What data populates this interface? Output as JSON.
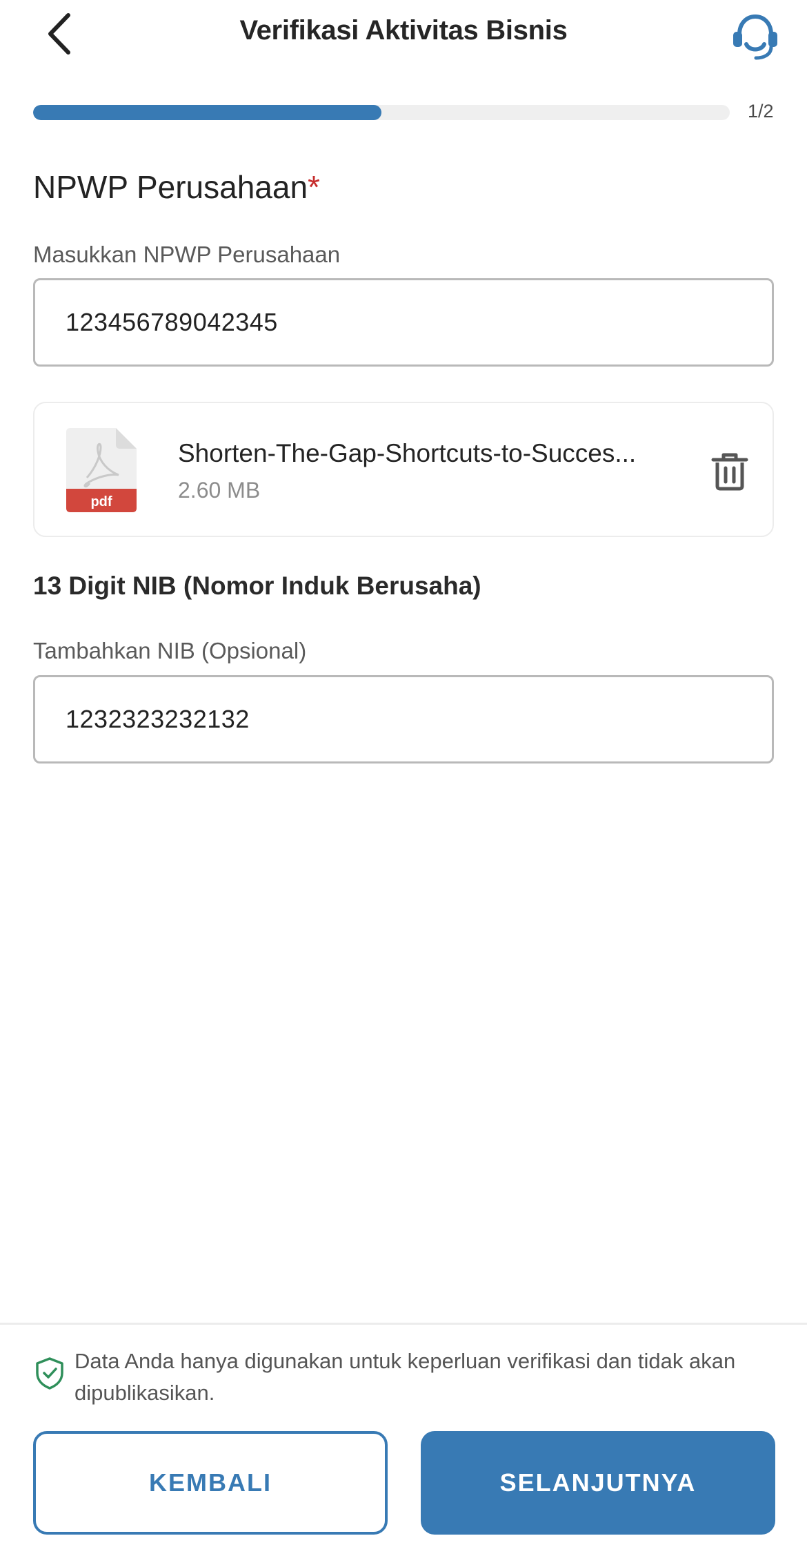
{
  "header": {
    "title": "Verifikasi Aktivitas Bisnis",
    "back_icon": "chevron-left-icon",
    "support_icon": "headset-icon"
  },
  "progress": {
    "step_label": "1/2",
    "fraction": 0.5
  },
  "npwp": {
    "title": "NPWP Perusahaan",
    "required_mark": "*",
    "label": "Masukkan NPWP Perusahaan",
    "value": "123456789042345"
  },
  "file": {
    "name": "Shorten-The-Gap-Shortcuts-to-Succes...",
    "size": "2.60 MB",
    "type_label": "pdf",
    "icon": "pdf-file-icon",
    "delete_icon": "trash-icon"
  },
  "nib": {
    "title": "13 Digit NIB (Nomor Induk Berusaha)",
    "label": "Tambahkan NIB (Opsional)",
    "value": "1232323232132"
  },
  "footer": {
    "note": "Data Anda hanya digunakan untuk keperluan verifikasi dan tidak akan dipublikasikan.",
    "shield_icon": "shield-check-icon",
    "back_label": "KEMBALI",
    "next_label": "SELANJUTNYA"
  },
  "colors": {
    "primary": "#387ab4",
    "required": "#c62b2b",
    "pdf_red": "#d2473d"
  }
}
